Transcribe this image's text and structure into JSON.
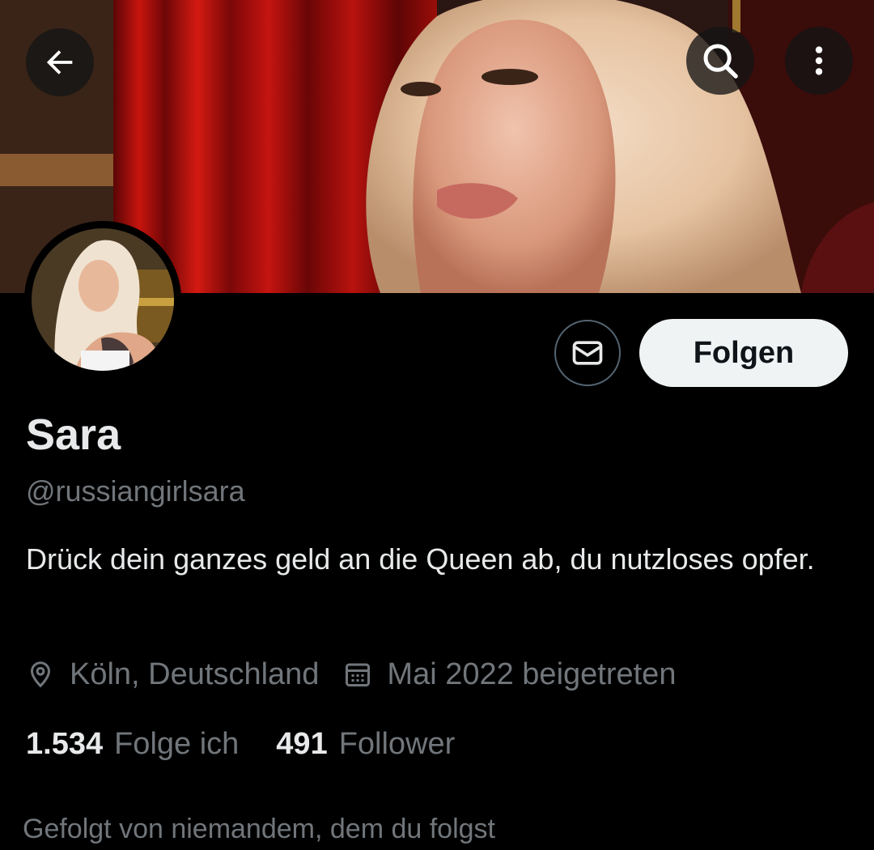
{
  "header": {
    "back_icon": "arrow-left-icon",
    "search_icon": "search-icon",
    "more_icon": "more-vertical-icon"
  },
  "profile": {
    "display_name": "Sara",
    "handle": "@russiangirlsara",
    "bio": "Drück dein ganzes geld an die Queen ab, du nutzloses opfer.",
    "location": "Köln, Deutschland",
    "joined": "Mai 2022 beigetreten",
    "following_count": "1.534",
    "following_label": "Folge ich",
    "followers_count": "491",
    "followers_label": "Follower",
    "followed_by": "Gefolgt von niemandem, dem du folgst"
  },
  "actions": {
    "message_icon": "envelope-icon",
    "follow_label": "Folgen"
  },
  "colors": {
    "background": "#000000",
    "text_primary": "#e7e9ea",
    "text_secondary": "#71767b",
    "follow_button_bg": "#eff3f4",
    "follow_button_text": "#0f1419",
    "outline_border": "#536471"
  }
}
